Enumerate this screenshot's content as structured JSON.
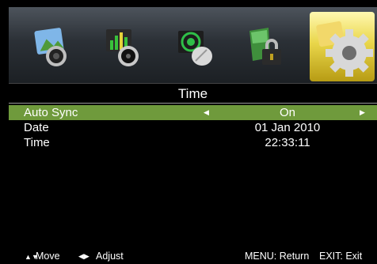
{
  "menu": {
    "icons": [
      {
        "name": "picture-icon"
      },
      {
        "name": "sound-icon"
      },
      {
        "name": "channel-icon"
      },
      {
        "name": "lock-icon"
      },
      {
        "name": "setup-gear-icon",
        "selected": true
      }
    ],
    "accent_color": "#e2cf3f"
  },
  "title": "Time",
  "rows": [
    {
      "label": "Auto Sync",
      "value": "On",
      "selected": true,
      "arrows": true
    },
    {
      "label": "Date",
      "value": "01 Jan 2010"
    },
    {
      "label": "Time",
      "value": "22:33:11"
    }
  ],
  "footer": {
    "move_label": "Move",
    "adjust_label": "Adjust",
    "menu_hint": "MENU: Return",
    "exit_hint": "EXIT: Exit"
  },
  "colors": {
    "selected_row": "#6f9a3c",
    "background": "#000000"
  }
}
